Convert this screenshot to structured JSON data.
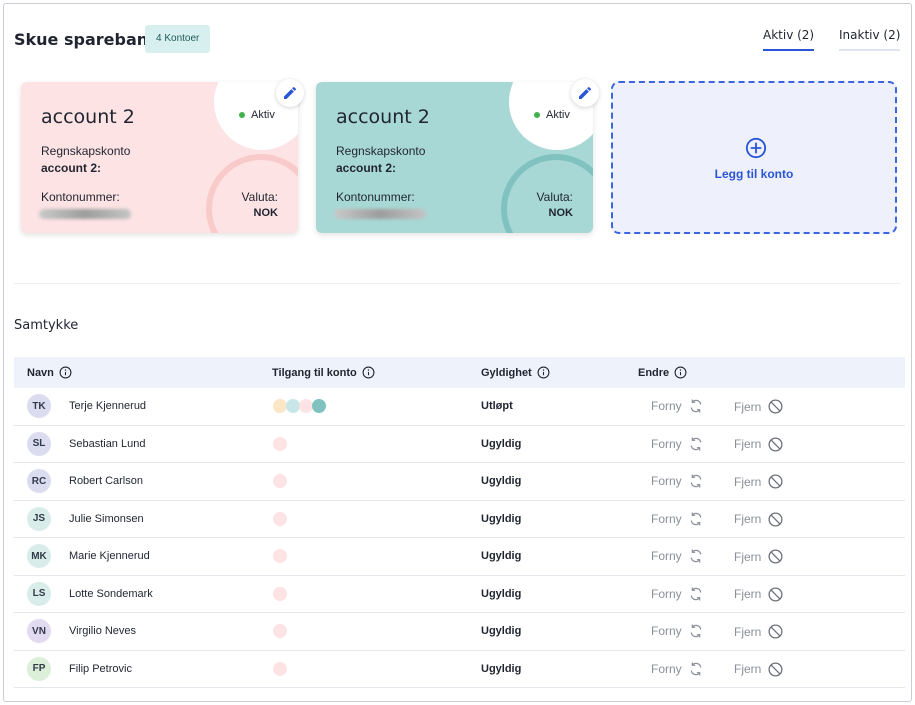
{
  "header": {
    "bank_name": "Skue sparebank",
    "account_count": "4 Kontoer",
    "tabs": [
      {
        "label": "Aktiv (2)",
        "active": true
      },
      {
        "label": "Inaktiv (2)",
        "active": false
      }
    ]
  },
  "accounts": [
    {
      "name": "account 2",
      "status": "Aktiv",
      "reg_label": "Regnskapskonto",
      "reg_name": "account 2:",
      "account_number_label": "Kontonummer:",
      "currency_label": "Valuta:",
      "currency": "NOK",
      "color": "#fde3e3"
    },
    {
      "name": "account 2",
      "status": "Aktiv",
      "reg_label": "Regnskapskonto",
      "reg_name": "account 2:",
      "account_number_label": "Kontonummer:",
      "currency_label": "Valuta:",
      "currency": "NOK",
      "color": "#a8d8d5"
    }
  ],
  "add_account": {
    "label": "Legg til konto"
  },
  "consents": {
    "title": "Samtykke",
    "columns": {
      "name": "Navn",
      "access": "Tilgang til konto",
      "validity": "Gyldighet",
      "change": "Endre"
    },
    "renew_label": "Forny",
    "remove_label": "Fjern",
    "rows": [
      {
        "initials": "TK",
        "name": "Terje Kjennerud",
        "validity": "Utløpt",
        "avatar_color": "#dcdcf0",
        "access_colors": [
          "#fbe7c6",
          "#c8e6e8",
          "#fde3e3",
          "#7fc2bf"
        ]
      },
      {
        "initials": "SL",
        "name": "Sebastian Lund",
        "validity": "Ugyldig",
        "avatar_color": "#dcdcf0",
        "access_colors": [
          "#fde3e3"
        ]
      },
      {
        "initials": "RC",
        "name": "Robert Carlson",
        "validity": "Ugyldig",
        "avatar_color": "#dcdcf0",
        "access_colors": [
          "#fde3e3"
        ]
      },
      {
        "initials": "JS",
        "name": "Julie Simonsen",
        "validity": "Ugyldig",
        "avatar_color": "#d8ecea",
        "access_colors": [
          "#fde3e3"
        ]
      },
      {
        "initials": "MK",
        "name": "Marie Kjennerud",
        "validity": "Ugyldig",
        "avatar_color": "#d8ecea",
        "access_colors": [
          "#fde3e3"
        ]
      },
      {
        "initials": "LS",
        "name": "Lotte Sondemark",
        "validity": "Ugyldig",
        "avatar_color": "#d8ecea",
        "access_colors": [
          "#fde3e3"
        ]
      },
      {
        "initials": "VN",
        "name": "Virgilio Neves",
        "validity": "Ugyldig",
        "avatar_color": "#e2daf0",
        "access_colors": [
          "#fde3e3"
        ]
      },
      {
        "initials": "FP",
        "name": "Filip Petrovic",
        "validity": "Ugyldig",
        "avatar_color": "#dcefd8",
        "access_colors": [
          "#fde3e3"
        ]
      }
    ]
  },
  "icons": {
    "edit": "pencil-icon",
    "add": "plus-circle-icon",
    "info": "info-icon",
    "renew": "refresh-icon",
    "remove": "block-icon"
  },
  "colors": {
    "accent": "#2a55d6",
    "status_active": "#3fb24d"
  }
}
